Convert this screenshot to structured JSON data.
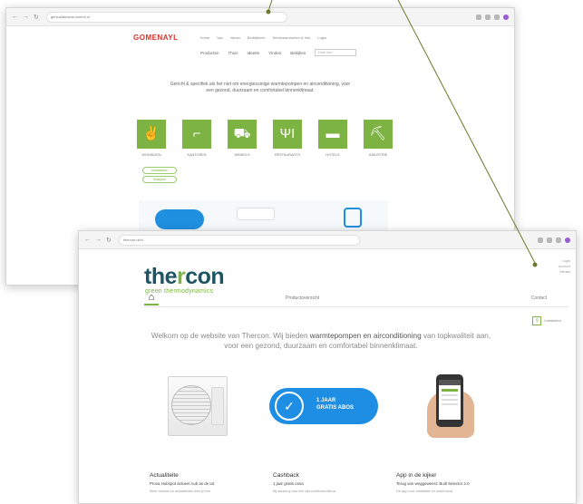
{
  "back_window": {
    "url": "geniusfalconar.com/nl-nl",
    "logo": "GOMENAYL",
    "top_links": [
      "Home",
      "Vac",
      "Vacan",
      "Bedrijfsinfo",
      "Werkzaamheden & Info",
      "Login"
    ],
    "menu": [
      "Producten",
      "Thuis",
      "Ideeën",
      "Vinden",
      "Bekijken"
    ],
    "search_placeholder": "Zoek hier",
    "intro": "Gericht & specifiek als het niet om energiezuinige warmtepompen en airconditioning, voor een gezond, duurzaam en comfortabel binnenklimaat.",
    "tiles": [
      {
        "icon": "toilet-icon",
        "glyph": "✌",
        "label": "WONINGEN"
      },
      {
        "icon": "office-chair-icon",
        "glyph": "⌐",
        "label": "KANTOREN"
      },
      {
        "icon": "cart-icon",
        "glyph": "⛟",
        "label": "WINKELS"
      },
      {
        "icon": "cutlery-icon",
        "glyph": "ΨΙ",
        "label": "RESTAURANTS"
      },
      {
        "icon": "bed-icon",
        "glyph": "▬",
        "label": "HOTELS"
      },
      {
        "icon": "forklift-icon",
        "glyph": "⛏",
        "label": "INDUSTRIE"
      }
    ],
    "badges": [
      "Installateur",
      "Bekijken"
    ]
  },
  "front_window": {
    "url": "thercon.nl/nl",
    "logo_part1": "the",
    "logo_part2": "r",
    "logo_part3": "con",
    "tagline": "green thermodynamics",
    "utility": [
      "Login",
      "Account",
      "Nieuws"
    ],
    "nav": {
      "home_glyph": "⌂",
      "item1": "Productoverzicht",
      "item2": "Contact"
    },
    "sub_link": "Installateur",
    "intro_before": "Welkom op de website van Thercon. Wij bieden ",
    "intro_bold": "warmtepompen en airconditioning",
    "intro_after": " van topkwaliteit aan, voor een gezond, duurzaam en comfortabel binnenklimaat.",
    "promo_line1": "1 JAAR",
    "promo_line2": "GRATIS ABOS",
    "columns": [
      {
        "title": "Actualiteite",
        "sub": "Prova Hubspot actueel Aub as de tot",
        "text": "Meer nieuws en actualiteiten lees je hier"
      },
      {
        "title": "Cashback",
        "sub": "1 jaar gratis onsa",
        "text": "Bij aankoop van een airconditioner/dienst"
      },
      {
        "title": "App in de kijker",
        "sub": "Terug van weggeweest: Built Selector 2.0",
        "text": "Dé app voor installatie en onderhoud"
      }
    ]
  }
}
